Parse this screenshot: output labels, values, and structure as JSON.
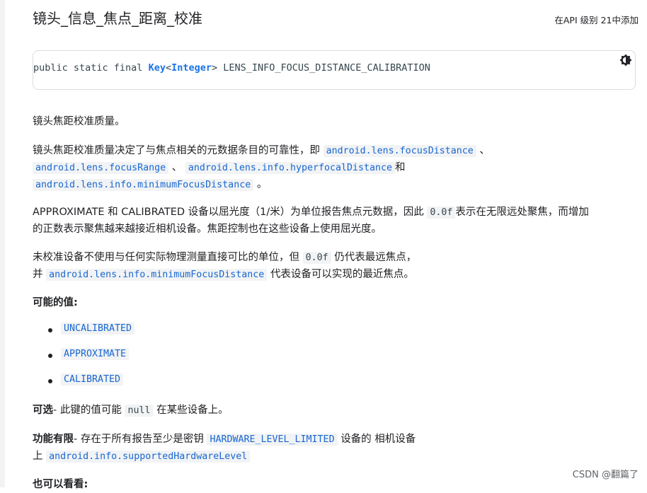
{
  "header": {
    "title": "镜头_信息_焦点_距离_校准",
    "added_in": "在API 级别 21中添加"
  },
  "signature": {
    "prefix": "public static final ",
    "type_key": "Key",
    "lt": "<",
    "type_int": "Integer",
    "gt": ">",
    "name": " LENS_INFO_FOCUS_DISTANCE_CALIBRATION"
  },
  "content": {
    "p1": "镜头焦距校准质量。",
    "p2": {
      "t1": "镜头焦距校准质量决定了与焦点相关的元数据条目的可靠性，即",
      "c1": "android.lens.focusDistance",
      "t2": "、",
      "c2": "android.lens.focusRange",
      "t3": "、",
      "c3": "android.lens.info.hyperfocalDistance",
      "t4": "和",
      "c4": "android.lens.info.minimumFocusDistance",
      "t5": "。"
    },
    "p3": {
      "t1": "APPROXIMATE 和 CALIBRATED 设备以屈光度（1/米）为单位报告焦点元数据，因此",
      "c1": "0.0f",
      "t2": "表示在无限远处聚焦，而增加",
      "line2": "的正数表示聚焦越来越接近相机设备。焦距控制也在这些设备上使用屈光度。"
    },
    "p4": {
      "t1": "未校准设备不使用与任何实际物理测量直接可比的单位，但",
      "c1": "0.0f",
      "t2": "仍代表最远焦点，",
      "t3": "并",
      "c2": "android.lens.info.minimumFocusDistance",
      "t4": "代表设备可以实现的最近焦点。"
    },
    "values_heading": "可能的值:",
    "values": [
      "UNCALIBRATED",
      "APPROXIMATE",
      "CALIBRATED"
    ],
    "optional": {
      "label": "可选",
      "t1": "- 此键的值可能",
      "c1": "null",
      "t2": "在某些设备上。"
    },
    "limited": {
      "label": "功能有限",
      "t1": "- 存在于所有报告至少是密钥",
      "c1": "HARDWARE_LEVEL_LIMITED",
      "t2": "设备的 相机设备",
      "t3": "上",
      "c2": "android.info.supportedHardwareLevel"
    },
    "see_also": "也可以看看:"
  },
  "watermark": "CSDN @翻篇了"
}
